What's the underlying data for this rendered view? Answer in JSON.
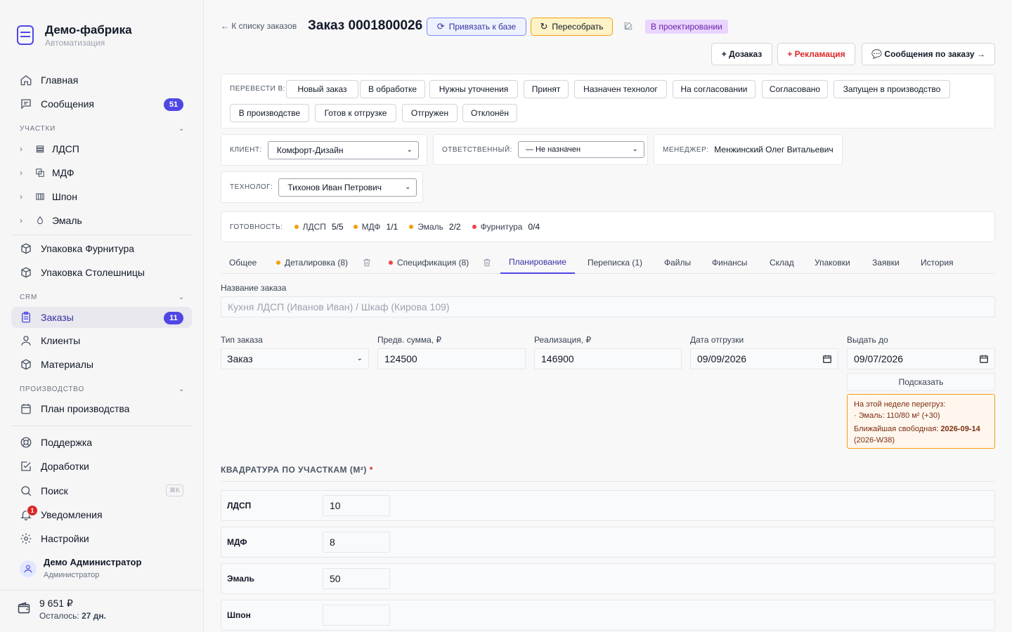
{
  "brand": {
    "title": "Демо-фабрика",
    "subtitle": "Автоматизация"
  },
  "nav": {
    "home": "Главная",
    "messages": "Сообщения",
    "messages_count": "51",
    "sections_label": "УЧАСТКИ",
    "sections": [
      "ЛДСП",
      "МДФ",
      "Шпон",
      "Эмаль"
    ],
    "pack_hardware": "Упаковка Фурнитура",
    "pack_tops": "Упаковка Столешницы",
    "crm_label": "CRM",
    "orders": "Заказы",
    "orders_count": "11",
    "clients": "Клиенты",
    "materials": "Материалы",
    "production_label": "ПРОИЗВОДСТВО",
    "production_plan": "План производства",
    "support": "Поддержка",
    "improvements": "Доработки",
    "search": "Поиск",
    "search_kbd": "⌘K",
    "notifications": "Уведомления",
    "notifications_count": "1",
    "settings": "Настройки"
  },
  "user": {
    "name": "Демо Администратор",
    "role": "Администратор"
  },
  "balance": {
    "amount": "9 651 ₽",
    "left_prefix": "Осталось:",
    "left_days": "27 дн."
  },
  "header": {
    "back": "← К списку заказов",
    "title": "Заказ 0001800026",
    "link_base": "Привязать к базе",
    "rebuild": "Пересобрать",
    "status": "В проектировании",
    "extra_order": "+ Дозаказ",
    "claim": "+ Рекламация",
    "order_messages": "💬 Сообщения по заказу →"
  },
  "transition": {
    "label": "ПЕРЕВЕСТИ В:",
    "states": [
      "Новый заказ",
      "В обработке",
      "Нужны уточнения",
      "Принят",
      "Назначен технолог",
      "На согласовании",
      "Согласовано",
      "Запущен в производство",
      "В производстве",
      "Готов к отгрузке",
      "Отгружен",
      "Отклонён"
    ]
  },
  "assign": {
    "client_label": "КЛИЕНТ:",
    "client_value": "Комфорт-Дизайн",
    "responsible_label": "ОТВЕТСТВЕННЫЙ:",
    "responsible_value": "— Не назначен",
    "manager_label": "МЕНЕДЖЕР:",
    "manager_value": "Менжинский Олег Витальевич",
    "technologist_label": "ТЕХНОЛОГ:",
    "technologist_value": "Тихонов Иван Петрович"
  },
  "readiness": {
    "label": "ГОТОВНОСТЬ:",
    "items": [
      {
        "name": "ЛДСП",
        "count": "5/5",
        "color": "#f59e0b"
      },
      {
        "name": "МДФ",
        "count": "1/1",
        "color": "#f59e0b"
      },
      {
        "name": "Эмаль",
        "count": "2/2",
        "color": "#f59e0b"
      },
      {
        "name": "Фурнитура",
        "count": "0/4",
        "color": "#ef4444"
      }
    ]
  },
  "tabs": [
    "Общее",
    "Деталировка (8)",
    "Спецификация (8)",
    "Планирование",
    "Переписка (1)",
    "Файлы",
    "Финансы",
    "Склад",
    "Упаковки",
    "Заявки",
    "История"
  ],
  "tab_dot_colors": {
    "details": "#f59e0b",
    "spec": "#ef4444"
  },
  "form": {
    "name_label": "Название заказа",
    "name_placeholder": "Кухня ЛДСП (Иванов Иван) / Шкаф (Кирова 109)",
    "type_label": "Тип заказа",
    "type_value": "Заказ",
    "prelim_label": "Предв. сумма, ₽",
    "prelim_value": "124500",
    "realization_label": "Реализация, ₽",
    "realization_value": "146900",
    "ship_date_label": "Дата отгрузки",
    "ship_date_value": "09/09/2026",
    "issue_by_label": "Выдать до",
    "issue_by_value": "09/07/2026",
    "hint_button": "Подсказать",
    "warn_line1": "На этой неделе перегруз:",
    "warn_line2": "· Эмаль: 110/80 м² (+30)",
    "warn_free_prefix": "Ближайшая свободная:",
    "warn_free_date": "2026-09-14",
    "warn_free_week": "(2026-W38)"
  },
  "squares": {
    "title": "КВАДРАТУРА ПО УЧАСТКАМ (М²)",
    "required": "*",
    "rows": [
      {
        "label": "ЛДСП",
        "value": "10"
      },
      {
        "label": "МДФ",
        "value": "8"
      },
      {
        "label": "Эмаль",
        "value": "50"
      },
      {
        "label": "Шпон",
        "value": ""
      }
    ]
  }
}
